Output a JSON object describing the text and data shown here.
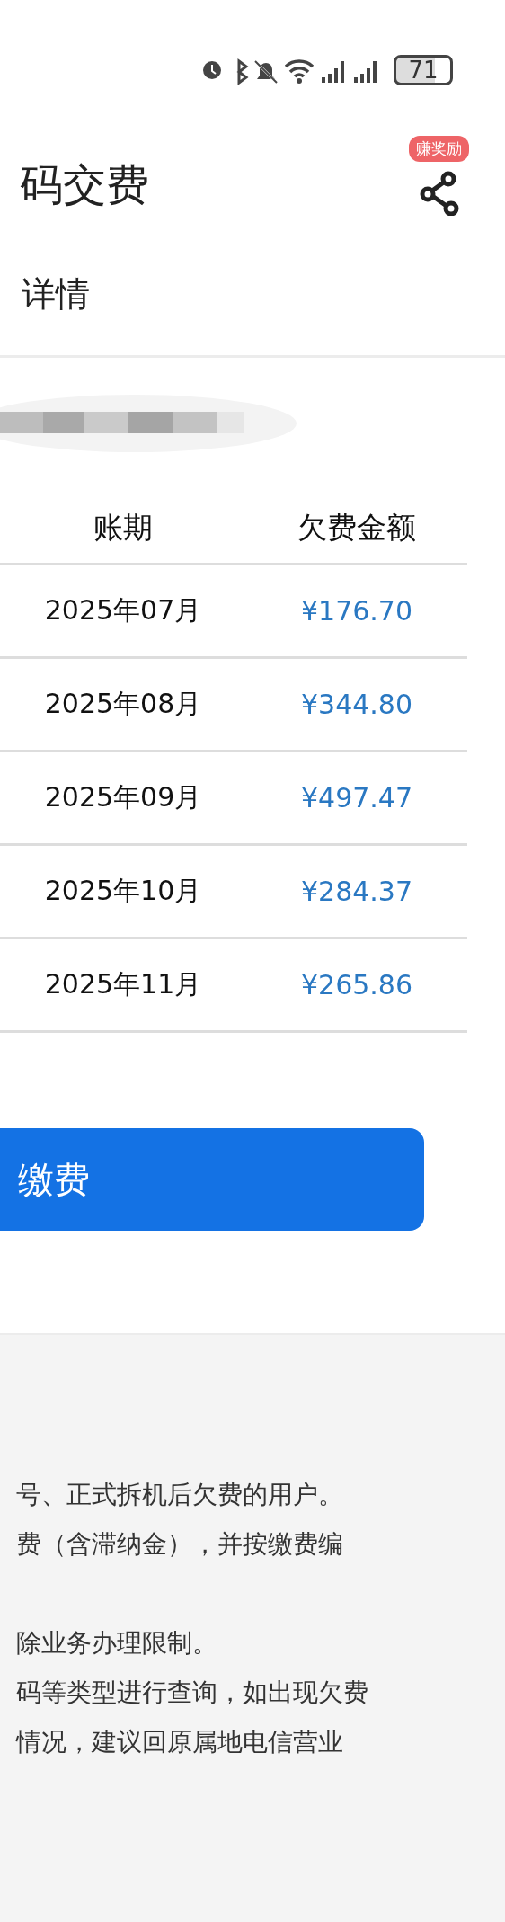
{
  "status_bar": {
    "battery": "71"
  },
  "header": {
    "title": "码交费",
    "badge": "赚奖励"
  },
  "subtitle": "详情",
  "account": {
    "kind": "picture"
  },
  "table": {
    "columns": [
      "账期",
      "欠费金额"
    ],
    "rows": [
      {
        "period": "2025年07月",
        "amount": "¥176.70"
      },
      {
        "period": "2025年08月",
        "amount": "¥344.80"
      },
      {
        "period": "2025年09月",
        "amount": "¥497.47"
      },
      {
        "period": "2025年10月",
        "amount": "¥284.37"
      },
      {
        "period": "2025年11月",
        "amount": "¥265.86"
      }
    ]
  },
  "pay_button": "缴费",
  "notes": [
    [
      "号、正式拆机后欠费的用户。",
      "费（含滞纳金），并按缴费编"
    ],
    [
      "除业务办理限制。",
      "码等类型进行查询，如出现欠费",
      "情况，建议回原属地电信营业"
    ]
  ]
}
